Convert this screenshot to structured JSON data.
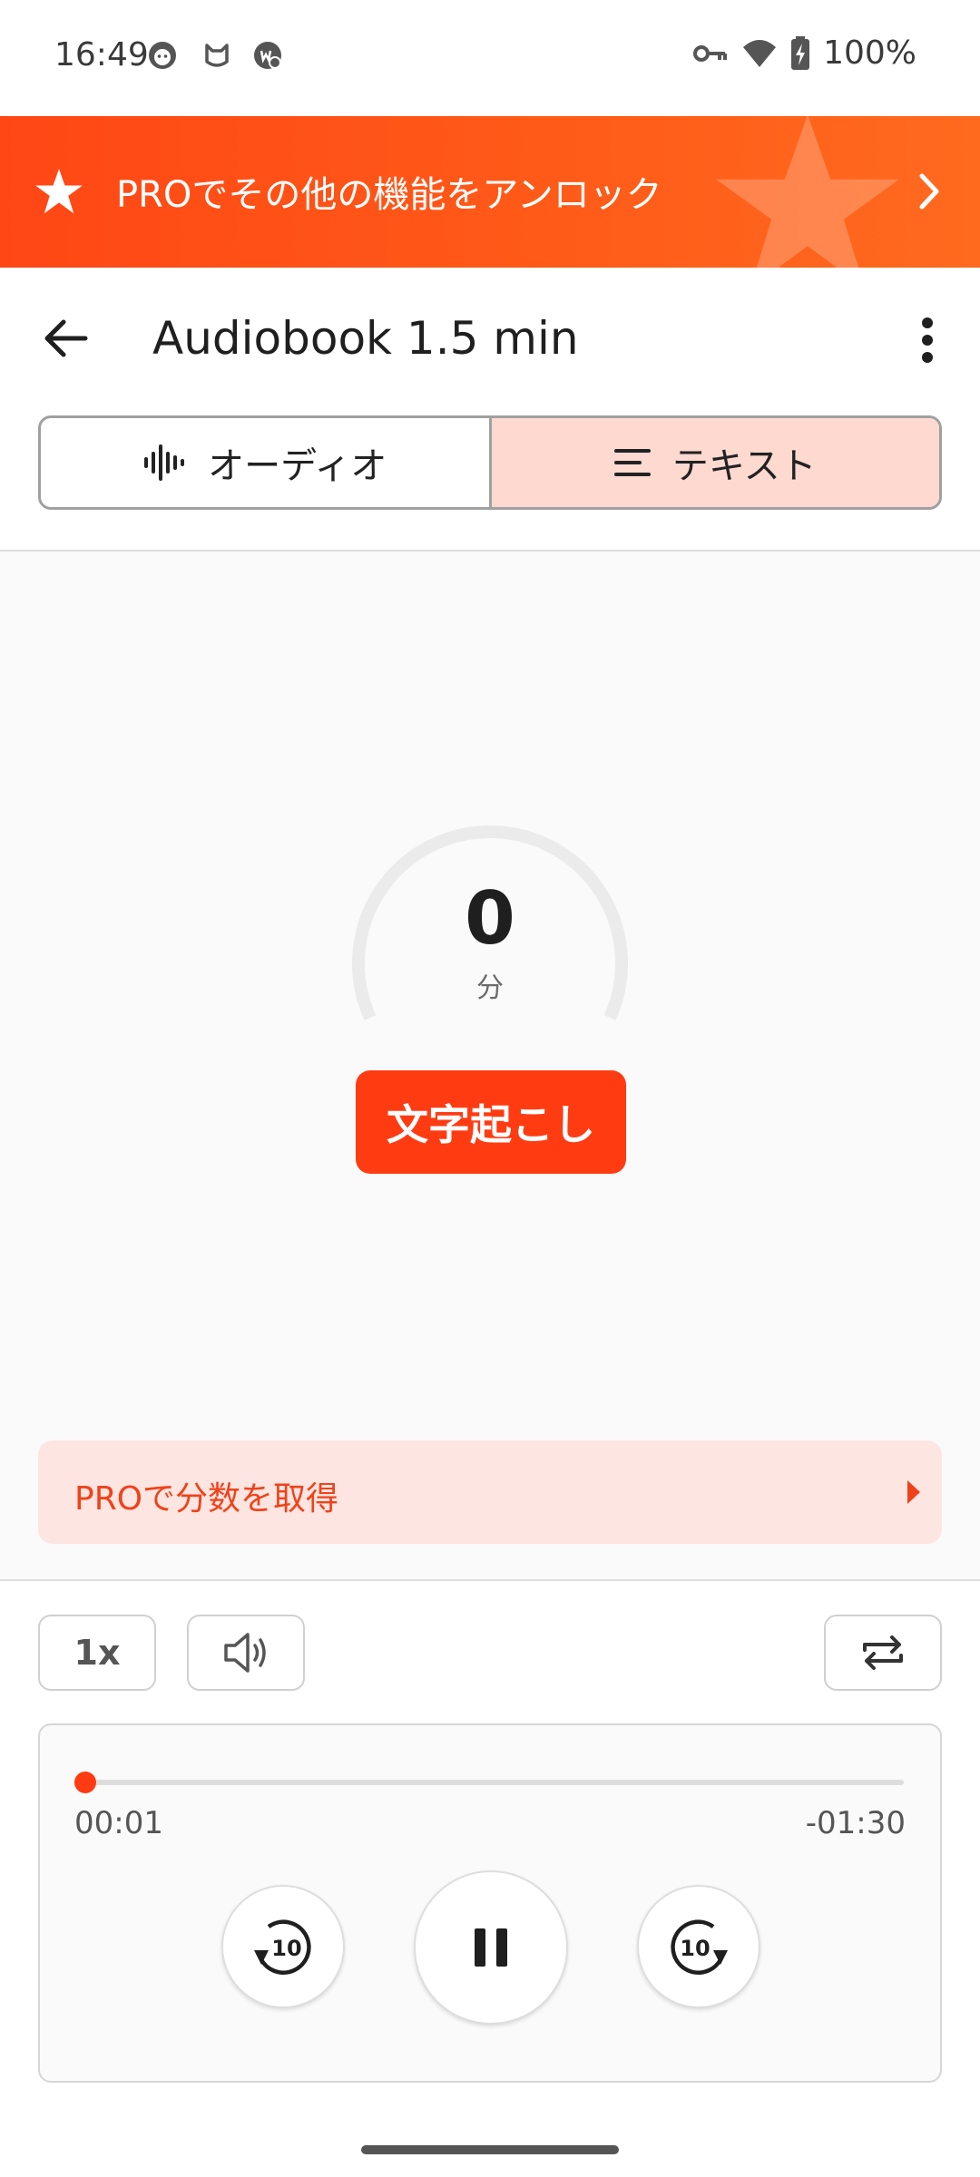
{
  "status_bar": {
    "time": "16:49",
    "battery": "100%",
    "icons": [
      "face-icon",
      "cat-icon",
      "app-badge-icon",
      "vpn-key-icon",
      "wifi-icon",
      "battery-charging-icon"
    ]
  },
  "banner": {
    "text": "PROでその他の機能をアンロック",
    "icon": "star-icon",
    "color": "#ff4715"
  },
  "header": {
    "title": "Audiobook 1.5 min"
  },
  "tabs": [
    {
      "label": "オーディオ",
      "icon": "waveform-icon",
      "active": false
    },
    {
      "label": "テキスト",
      "icon": "text-lines-icon",
      "active": true
    }
  ],
  "gauge": {
    "value": "0",
    "unit": "分"
  },
  "transcribe_button": {
    "label": "文字起こし",
    "color": "#ff3b12"
  },
  "pro_bar": {
    "text": "PROで分数を取得"
  },
  "controls": {
    "speed_label": "1x",
    "volume_icon": "volume-icon",
    "loop_icon": "repeat-icon"
  },
  "player": {
    "elapsed": "00:01",
    "remaining": "-01:30",
    "progress": 0.011,
    "rewind_label": "10",
    "forward_label": "10",
    "state": "playing"
  }
}
